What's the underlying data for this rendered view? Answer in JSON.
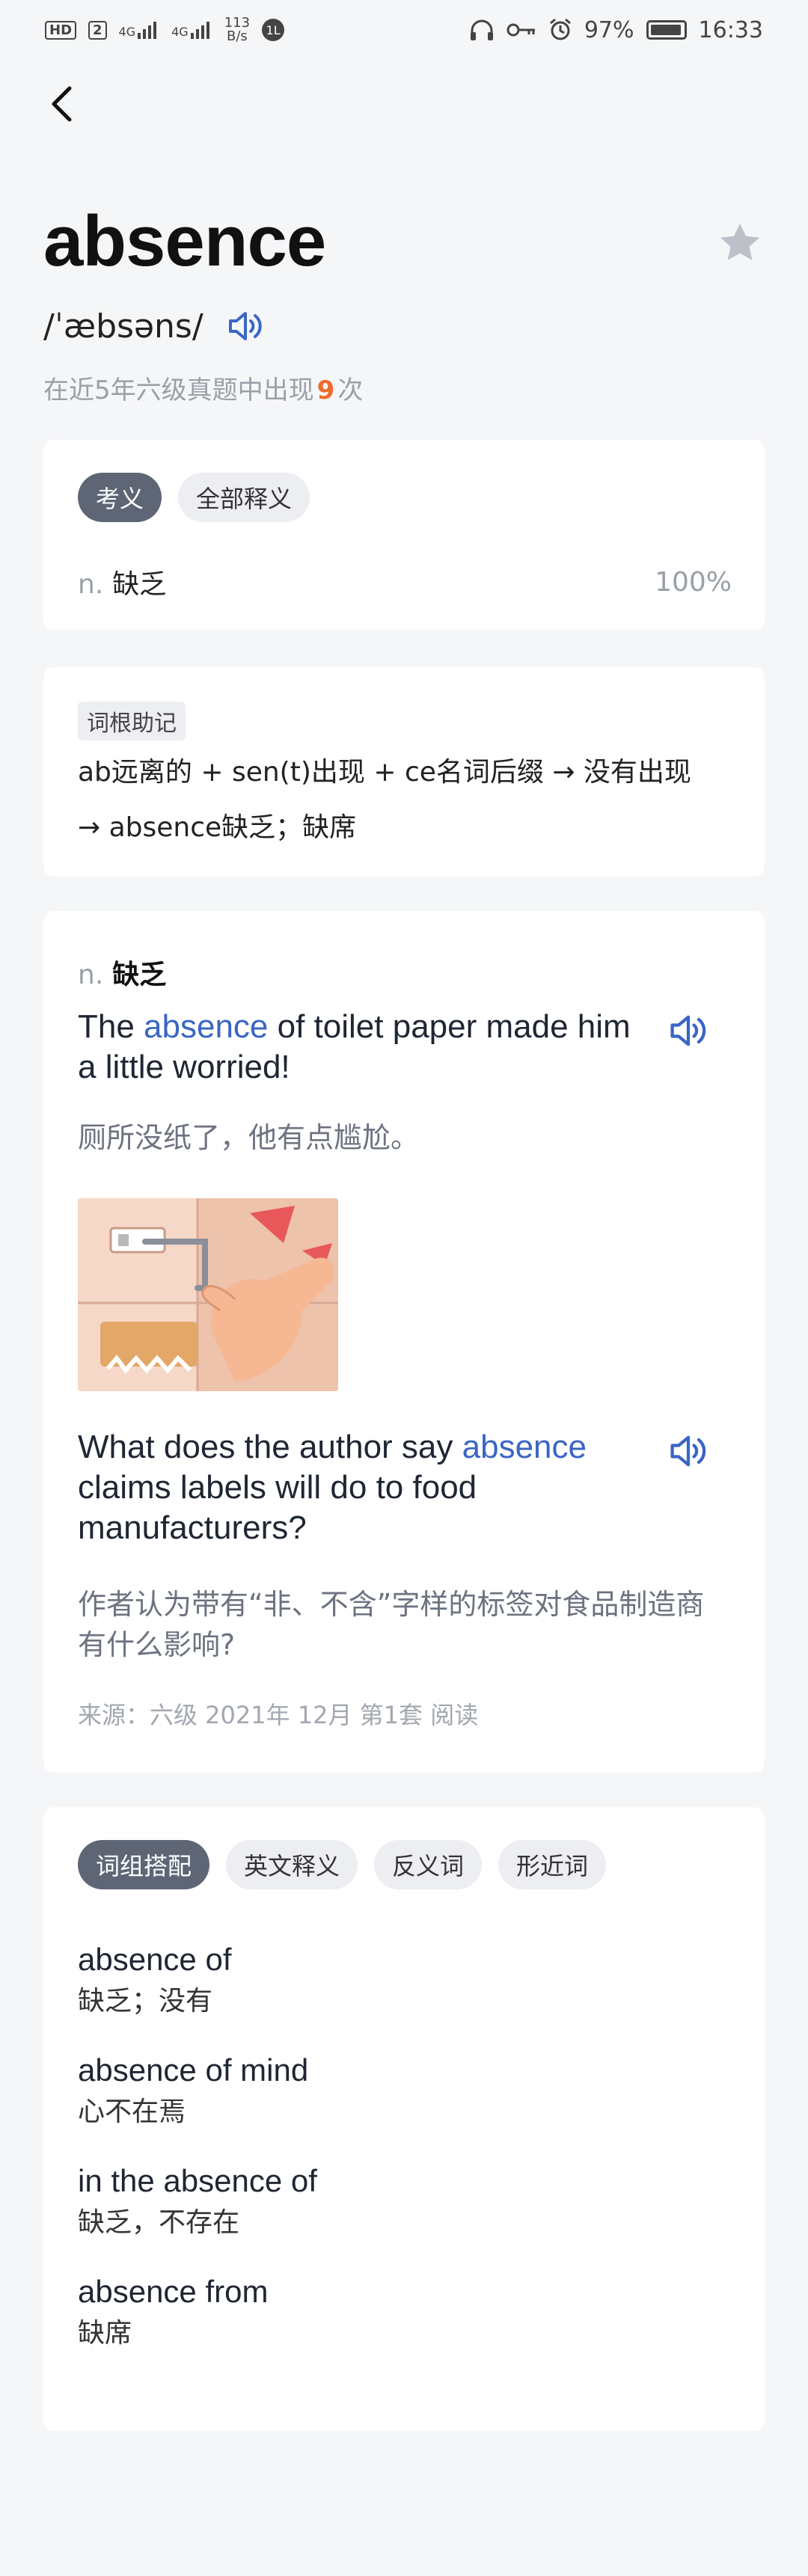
{
  "status_bar": {
    "hd_label": "HD",
    "sim2": "2",
    "net1": "4G",
    "net2": "4G",
    "speed_value": "113",
    "speed_unit": "B/s",
    "misc_badge": "1L",
    "battery": "97%",
    "time": "16:33"
  },
  "word": {
    "title": "absence",
    "phonetic": "/ˈæbsəns/",
    "freq_prefix": "在近5年六级真题中出现",
    "freq_count": "9",
    "freq_suffix": "次"
  },
  "definitions_card": {
    "tabs": [
      "考义",
      "全部释义"
    ],
    "active_tab": 0,
    "pos": "n.",
    "meaning": "缺乏",
    "percent": "100%"
  },
  "mnemonic_card": {
    "tag": "词根助记",
    "line1": "ab远离的 + sen(t)出现 + ce名词后缀 → 没有出现",
    "line2": "→ absence缺乏；缺席"
  },
  "example_card": {
    "pos": "n.",
    "meaning": "缺乏",
    "example1": {
      "before": "The ",
      "highlight": "absence",
      "after": " of toilet paper made him a little worried!",
      "translation": "厕所没纸了，他有点尴尬。"
    },
    "example2": {
      "before": "What does the author say ",
      "highlight": "absence",
      "after": " claims labels will do to food manufacturers?",
      "translation": "作者认为带有“非、不含”字样的标签对食品制造商有什么影响?"
    },
    "source": "来源：六级 2021年 12月 第1套 阅读"
  },
  "phrases_card": {
    "tabs": [
      "词组搭配",
      "英文释义",
      "反义词",
      "形近词"
    ],
    "active_tab": 0,
    "items": [
      {
        "en": "absence of",
        "zh": "缺乏；没有"
      },
      {
        "en": "absence of mind",
        "zh": "心不在焉"
      },
      {
        "en": "in the absence of",
        "zh": "缺乏，不存在"
      },
      {
        "en": "absence from",
        "zh": "缺席"
      }
    ]
  },
  "colors": {
    "accent_blue": "#3a66c4",
    "freq_orange": "#f06a2a",
    "active_tab": "#5e6675"
  }
}
